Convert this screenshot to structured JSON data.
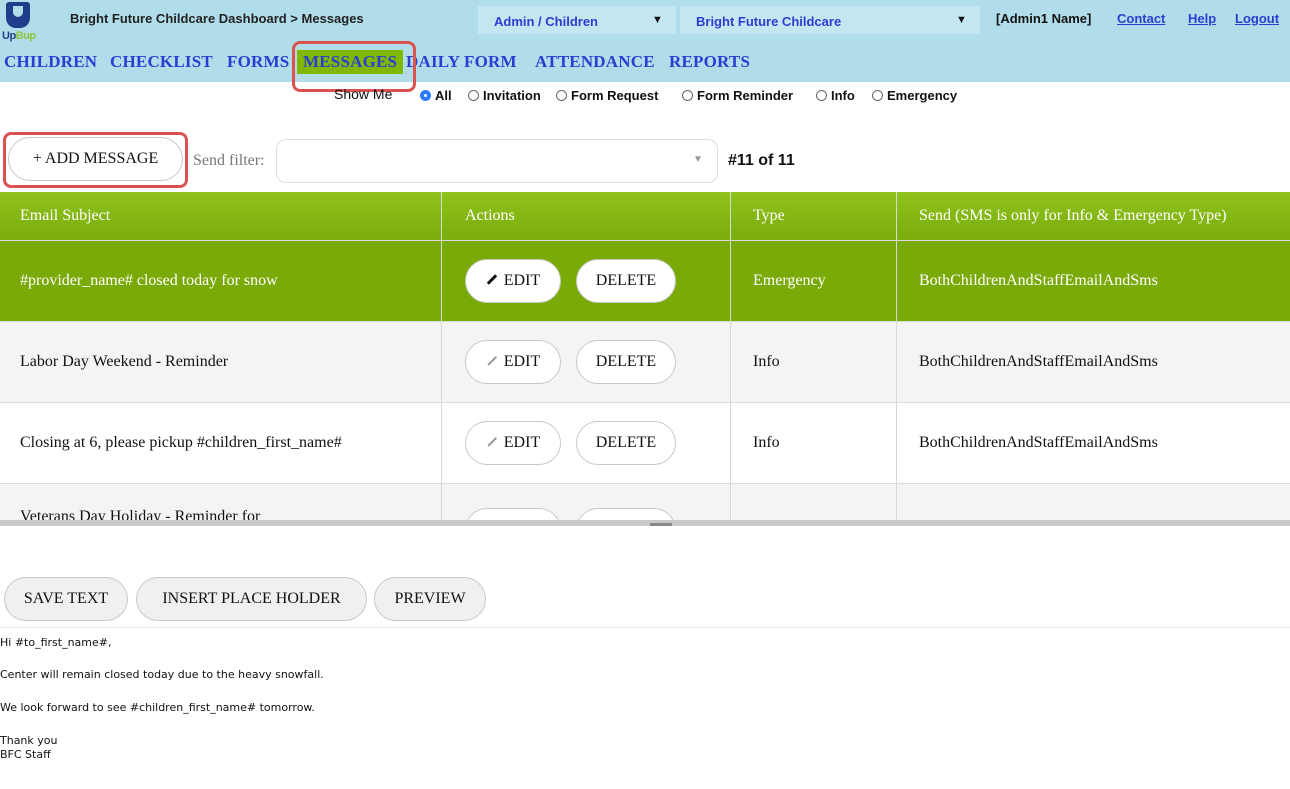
{
  "header": {
    "logo": "UpBup",
    "breadcrumb": "Bright Future Childcare Dashboard > Messages",
    "role_select": "Admin / Children",
    "center_select": "Bright Future Childcare",
    "admin_name": "[Admin1 Name]",
    "links": [
      "Contact",
      "Help",
      "Logout"
    ]
  },
  "nav": {
    "items": [
      "CHILDREN",
      "CHECKLIST",
      "FORMS",
      "MESSAGES",
      "DAILY FORM",
      "ATTENDANCE",
      "REPORTS"
    ],
    "active": "MESSAGES"
  },
  "filter": {
    "label": "Show Me",
    "options": [
      "All",
      "Invitation",
      "Form Request",
      "Form Reminder",
      "Info",
      "Emergency"
    ],
    "selected": "All"
  },
  "toolbar": {
    "add_label": "+ ADD MESSAGE",
    "send_filter_label": "Send filter:",
    "send_filter_value": "",
    "count": "#11 of 11"
  },
  "table": {
    "columns": [
      "Email Subject",
      "Actions",
      "Type",
      "Send (SMS is only for Info & Emergency Type)"
    ],
    "edit_label": "EDIT",
    "delete_label": "DELETE",
    "rows": [
      {
        "subject": "#provider_name# closed today for snow",
        "type": "Emergency",
        "send": "BothChildrenAndStaffEmailAndSms",
        "selected": true
      },
      {
        "subject": "Labor Day Weekend - Reminder",
        "type": "Info",
        "send": "BothChildrenAndStaffEmailAndSms",
        "selected": false
      },
      {
        "subject": "Closing at 6, please pickup #children_first_name#",
        "type": "Info",
        "send": "BothChildrenAndStaffEmailAndSms",
        "selected": false
      },
      {
        "subject": "Veterans Day Holiday - Reminder for",
        "type": "",
        "send": "",
        "selected": false
      }
    ]
  },
  "editor": {
    "buttons": [
      "SAVE TEXT",
      "INSERT PLACE HOLDER",
      "PREVIEW"
    ],
    "body": [
      "Hi #to_first_name#,",
      "Center will remain closed today due to the heavy snowfall.",
      "We look forward to see #children_first_name# tomorrow.",
      "Thank you",
      "BFC Staff"
    ]
  },
  "colors": {
    "header_bg": "#b0dde9",
    "link_blue": "#2b3ed1",
    "table_green": "#7aaa08",
    "highlight_red": "#d9534f"
  }
}
